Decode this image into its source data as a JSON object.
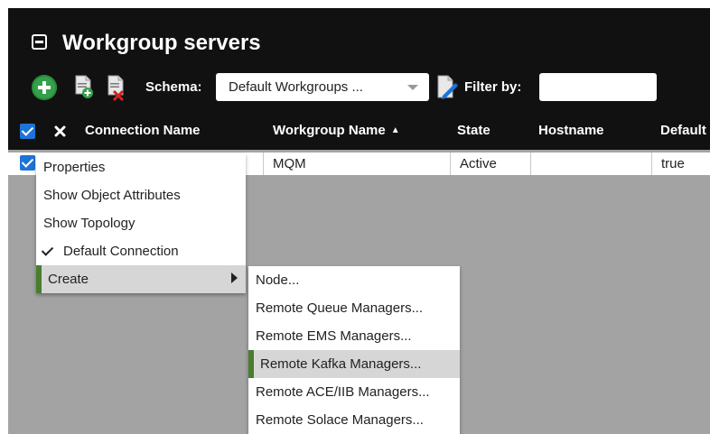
{
  "panel": {
    "title": "Workgroup servers"
  },
  "toolbar": {
    "schema_label": "Schema:",
    "schema_value": "Default Workgroups ...",
    "filter_label": "Filter by:",
    "filter_value": ""
  },
  "table": {
    "select_all_checked": true,
    "headers": {
      "connection_name": "Connection Name",
      "workgroup_name": "Workgroup Name",
      "state": "State",
      "hostname": "Hostname",
      "default": "Default"
    },
    "sort_column": "workgroup_name",
    "sort_direction": "ascending",
    "rows": [
      {
        "checked": true,
        "connection_name": "",
        "workgroup_name": "MQM",
        "state": "Active",
        "hostname": "",
        "default": "true"
      }
    ]
  },
  "context_menu": {
    "items": [
      {
        "label": "Properties"
      },
      {
        "label": "Show Object Attributes"
      },
      {
        "label": "Show Topology"
      },
      {
        "label": "Default Connection",
        "checked": true
      },
      {
        "label": "Create",
        "has_submenu": true,
        "active": true
      }
    ]
  },
  "submenu": {
    "items": [
      {
        "label": "Node..."
      },
      {
        "label": "Remote Queue Managers..."
      },
      {
        "label": "Remote EMS Managers..."
      },
      {
        "label": "Remote Kafka Managers...",
        "active": true
      },
      {
        "label": "Remote ACE/IIB Managers..."
      },
      {
        "label": "Remote Solace Managers..."
      }
    ]
  },
  "colors": {
    "panel_bg": "#111111",
    "grid_bg": "#a3a3a3",
    "checkbox_blue": "#1e73d8",
    "add_green": "#35a04b",
    "menu_accent": "#4a7d2e",
    "menu_highlight": "#d6d6d6"
  },
  "icons": {
    "collapse": "minus-square-icon",
    "add": "add-circle-icon",
    "add_document": "add-document-icon",
    "delete_document": "delete-document-icon",
    "filter": "filter-icon",
    "clear": "close-icon",
    "checked": "checkmark-icon",
    "submenu": "chevron-right-icon"
  }
}
